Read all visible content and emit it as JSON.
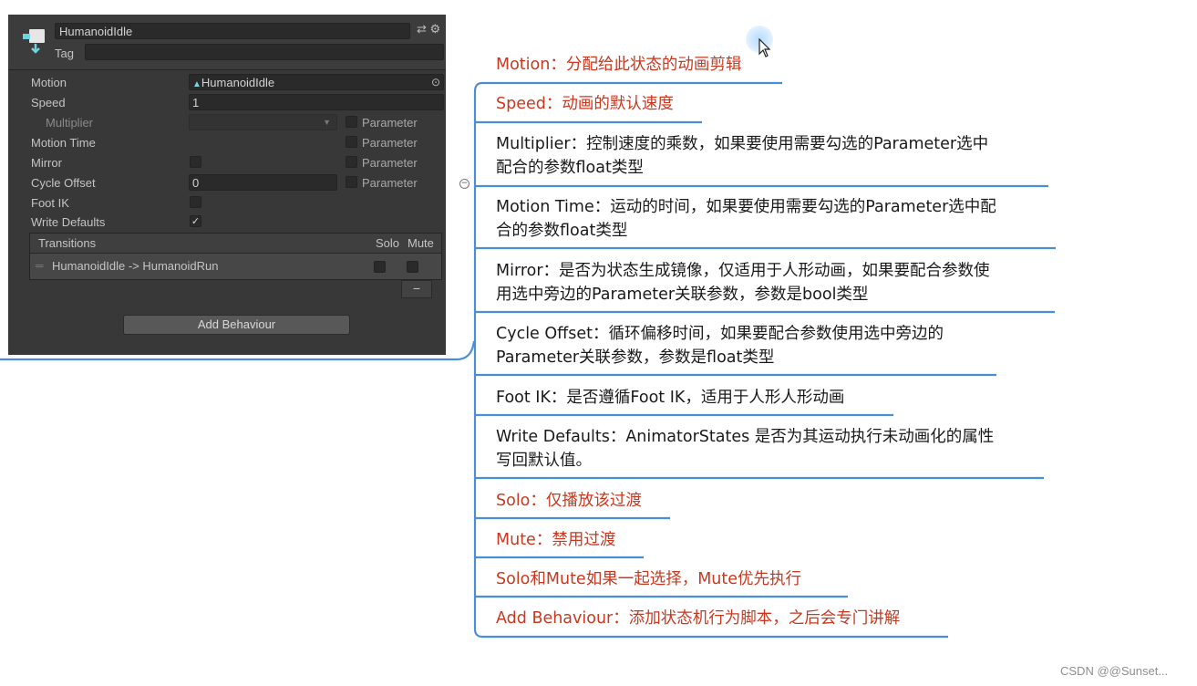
{
  "inspector": {
    "state_name": "HumanoidIdle",
    "tag_label": "Tag",
    "header_icons": "⇄ ⚙",
    "rows": {
      "motion_label": "Motion",
      "motion_value": "HumanoidIdle",
      "speed_label": "Speed",
      "speed_value": "1",
      "multiplier_label": "Multiplier",
      "motion_time_label": "Motion Time",
      "mirror_label": "Mirror",
      "cycle_offset_label": "Cycle Offset",
      "cycle_offset_value": "0",
      "foot_ik_label": "Foot IK",
      "write_defaults_label": "Write Defaults",
      "write_defaults_checked": true,
      "parameter_label": "Parameter"
    },
    "transitions": {
      "title": "Transitions",
      "solo_label": "Solo",
      "mute_label": "Mute",
      "items": [
        "HumanoidIdle -> HumanoidRun"
      ],
      "remove_label": "−"
    },
    "add_behaviour_label": "Add Behaviour"
  },
  "mindmap": {
    "nodes": [
      {
        "line1": "Motion：分配给此状态的动画剪辑",
        "line2": "",
        "color": "#c9381f"
      },
      {
        "line1": "Speed：动画的默认速度",
        "line2": "",
        "color": "#c9381f"
      },
      {
        "line1": "Multiplier：控制速度的乘数，如果要使用需要勾选的Parameter选中",
        "line2": "配合的参数float类型",
        "color": "#1a1a1a"
      },
      {
        "line1": "Motion Time：运动的时间，如果要使用需要勾选的Parameter选中配",
        "line2": "合的参数float类型",
        "color": "#1a1a1a"
      },
      {
        "line1": "Mirror：是否为状态生成镜像，仅适用于人形动画，如果要配合参数使",
        "line2": "用选中旁边的Parameter关联参数，参数是bool类型",
        "color": "#1a1a1a"
      },
      {
        "line1": "Cycle Offset：循环偏移时间，如果要配合参数使用选中旁边的",
        "line2": "Parameter关联参数，参数是float类型",
        "color": "#1a1a1a"
      },
      {
        "line1": "Foot IK：是否遵循Foot IK，适用于人形人形动画",
        "line2": "",
        "color": "#1a1a1a"
      },
      {
        "line1": "Write Defaults：AnimatorStates 是否为其运动执行未动画化的属性",
        "line2": "写回默认值。",
        "color": "#1a1a1a"
      },
      {
        "line1": "Solo：仅播放该过渡",
        "line2": "",
        "color": "#c9381f"
      },
      {
        "line1": "Mute：禁用过渡",
        "line2": "",
        "color": "#c9381f"
      },
      {
        "line1": "Solo和Mute如果一起选择，Mute优先执行",
        "line2": "",
        "color": "#c9381f"
      },
      {
        "line1": "Add Behaviour：添加状态机行为脚本，之后会专门讲解",
        "line2": "",
        "color": "#c9381f"
      }
    ],
    "link_color": "#4a8fd6"
  },
  "watermark": "CSDN @@Sunset..."
}
